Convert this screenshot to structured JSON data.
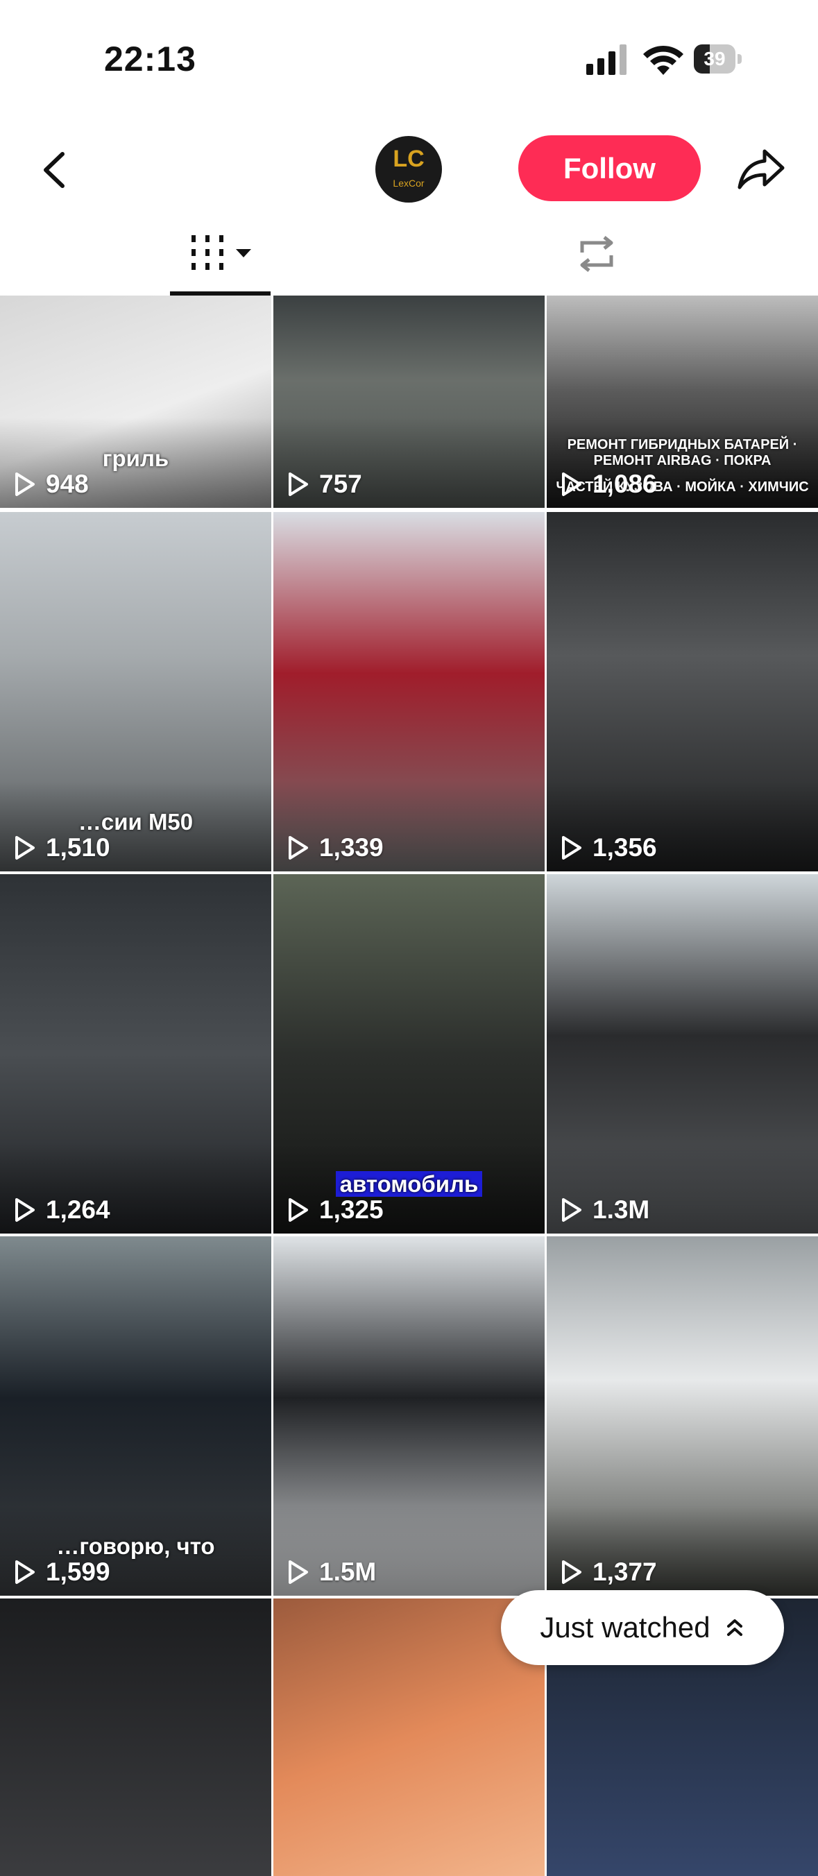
{
  "status_bar": {
    "time": "22:13",
    "battery": "39",
    "battery_level": 0.39
  },
  "header": {
    "avatar_text": "LC",
    "avatar_name": "LexCor",
    "follow_label": "Follow"
  },
  "tabs": {
    "videos_icon": "grid-icon",
    "reposts_icon": "repost-icon"
  },
  "videos": [
    {
      "views": "948",
      "caption": "гриль",
      "bg": "linear-gradient(160deg,#d7d7d7 0%,#eeeeee 55%,#9a9a9a 100%)"
    },
    {
      "views": "757",
      "caption": "",
      "bg": "linear-gradient(180deg,#3b4041 0%,#6a6f6b 40%,#4d524f 100%)"
    },
    {
      "views": "1,086",
      "caption": "РЕМОНТ ГИБРИДНЫХ БАТАРЕЙ · РЕМОНТ AIRBAG · ПОКРА",
      "caption2": "ЧАСТЕЙ КУЗОВА · МОЙКА · ХИМЧИС",
      "bg": "linear-gradient(180deg,#bdbdbd 0%,#5b5b5b 45%,#161616 100%)"
    },
    {
      "views": "1,510",
      "caption": "…сии M50",
      "bg": "linear-gradient(180deg,#c7ccd0 0%,#a5aaad 40%,#54585a 100%)"
    },
    {
      "views": "1,339",
      "caption": "",
      "bg": "linear-gradient(180deg,#d9dde3 0%,#a01d2b 45%,#6f6f6f 100%)"
    },
    {
      "views": "1,356",
      "caption": "",
      "bg": "linear-gradient(180deg,#2a2c2e 0%,#57595b 40%,#1c1d1e 100%)"
    },
    {
      "views": "1,264",
      "caption": "",
      "bg": "linear-gradient(180deg,#2e3236 0%,#4a4e52 50%,#1f2124 100%)"
    },
    {
      "views": "1,325",
      "caption": "автомобиль",
      "bg": "linear-gradient(180deg,#5c6556 0%,#2c2f2c 50%,#141514 100%)"
    },
    {
      "views": "1.3M",
      "caption": "",
      "bg": "linear-gradient(180deg,#cfd6da 0%,#2a2b2d 45%,#5a5d60 100%)"
    },
    {
      "views": "1,599",
      "caption": "…говорю, что",
      "bg": "linear-gradient(180deg,#7f8a8e 0%,#1a2027 45%,#3a3d40 100%)"
    },
    {
      "views": "1.5M",
      "caption": "",
      "bg": "linear-gradient(180deg,#dfe3e6 0%,#1f2124 45%,#d6d8da 100%)"
    },
    {
      "views": "1,377",
      "caption": "",
      "bg": "linear-gradient(180deg,#9aa0a3 0%,#e7e9ea 40%,#3d3f3a 100%)"
    },
    {
      "views": "",
      "caption": "",
      "bg": "linear-gradient(180deg,#1c1d1f 0%,#3b3c3f 100%)"
    },
    {
      "views": "",
      "caption": "",
      "bg": "linear-gradient(160deg,#9c5b3d 0%,#e38a5a 50%,#f2b48b 100%)"
    },
    {
      "views": "",
      "caption": "",
      "bg": "linear-gradient(180deg,#1d2532 0%,#35466a 100%)"
    }
  ],
  "just_watched": {
    "label": "Just watched"
  }
}
